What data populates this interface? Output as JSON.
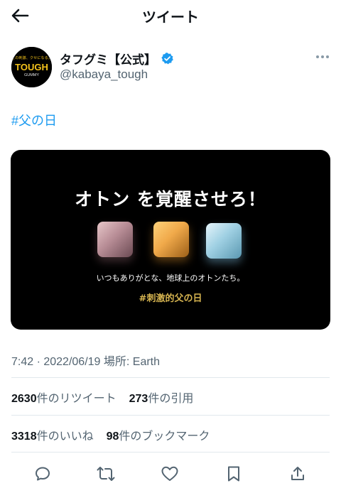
{
  "header": {
    "title": "ツイート"
  },
  "author": {
    "name": "タフグミ【公式】",
    "handle": "@kabaya_tough",
    "avatar_top_text": "この刺激、クセになる。",
    "avatar_main_text": "TOUGH",
    "avatar_sub_text": "GUMMY",
    "verified_color": "#1d9bf0"
  },
  "tweet": {
    "hashtag": "#父の日",
    "media": {
      "headline": "オトン を覚醒させろ！",
      "subline": "いつもありがとな、地球上のオトンたち。",
      "tagline": "#刺激的父の日"
    },
    "meta": "7:42 · 2022/06/19 場所: Earth"
  },
  "stats": {
    "retweets_count": "2630",
    "retweets_label": "件のリツイート",
    "quotes_count": "273",
    "quotes_label": "件の引用",
    "likes_count": "3318",
    "likes_label": "件のいいね",
    "bookmarks_count": "98",
    "bookmarks_label": "件のブックマーク"
  },
  "actions": [
    "reply-icon",
    "retweet-icon",
    "like-icon",
    "bookmark-icon",
    "share-icon"
  ],
  "colors": {
    "link": "#1d9bf0",
    "muted": "#536471",
    "text": "#0f1419",
    "gold": "#d6b450"
  }
}
